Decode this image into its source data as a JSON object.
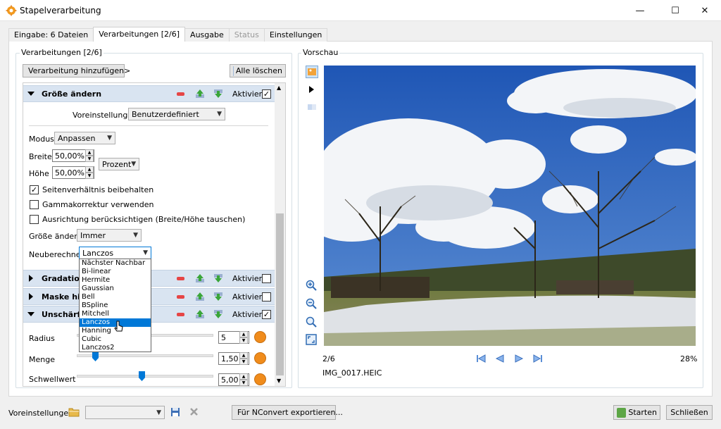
{
  "window": {
    "title": "Stapelverarbeitung",
    "minimize": "—",
    "maximize": "☐",
    "close": "✕"
  },
  "tabs": [
    {
      "label": "Eingabe: 6 Dateien",
      "state": "normal"
    },
    {
      "label": "Verarbeitungen [2/6]",
      "state": "active"
    },
    {
      "label": "Ausgabe",
      "state": "normal"
    },
    {
      "label": "Status",
      "state": "disabled"
    },
    {
      "label": "Einstellungen",
      "state": "normal"
    }
  ],
  "processing": {
    "group_label": "Verarbeitungen [2/6]",
    "add_button": "Verarbeitung hinzufügen>",
    "clear_button": "Alle löschen",
    "sections": [
      {
        "title": "Größe ändern",
        "active_label": "Aktiviert",
        "checked": true,
        "expanded": true
      },
      {
        "title": "Gradations",
        "active_label": "Aktiviert",
        "checked": false,
        "expanded": false
      },
      {
        "title": "Maske hin",
        "active_label": "Aktiviert",
        "checked": false,
        "expanded": false
      },
      {
        "title": "Unschärfe",
        "active_label": "Aktiviert",
        "checked": true,
        "expanded": true
      }
    ],
    "resize": {
      "presets_label": "Voreinstellungen",
      "presets_value": "Benutzerdefiniert",
      "mode_label": "Modus",
      "mode_value": "Anpassen",
      "width_label": "Breite",
      "width_value": "50,00%",
      "height_label": "Höhe",
      "height_value": "50,00%",
      "unit_value": "Prozent",
      "keep_ratio_label": "Seitenverhältnis beibehalten",
      "keep_ratio_checked": true,
      "gamma_label": "Gammakorrektur verwenden",
      "gamma_checked": false,
      "orientation_label": "Ausrichtung berücksichtigen (Breite/Höhe tauschen)",
      "orientation_checked": false,
      "resize_when_label": "Größe ändern",
      "resize_when_value": "Immer",
      "resample_label": "Neuberechnen",
      "resample_value": "Lanczos",
      "resample_options": [
        "Nächster Nachbar",
        "Bi-linear",
        "Hermite",
        "Gaussian",
        "Bell",
        "BSpline",
        "Mitchell",
        "Lanczos",
        "Hanning",
        "Cubic",
        "Lanczos2"
      ],
      "resample_highlighted": "Lanczos"
    },
    "unsharp": {
      "radius_label": "Radius",
      "radius_value": "5",
      "amount_label": "Menge",
      "amount_value": "1,50",
      "threshold_label": "Schwellwert",
      "threshold_value": "5,00"
    }
  },
  "preview": {
    "group_label": "Vorschau",
    "counter": "2/6",
    "filename": "IMG_0017.HEIC",
    "zoom": "28%"
  },
  "footer": {
    "presets_label": "Voreinstellungen:",
    "presets_value": "",
    "export_button": "Für NConvert exportieren...",
    "start_button": "Starten",
    "close_button": "Schließen"
  },
  "colors": {
    "accent": "#0078d7",
    "section_header": "#d9e4f1",
    "remove": "#e64545",
    "move": "#3aa53a"
  }
}
